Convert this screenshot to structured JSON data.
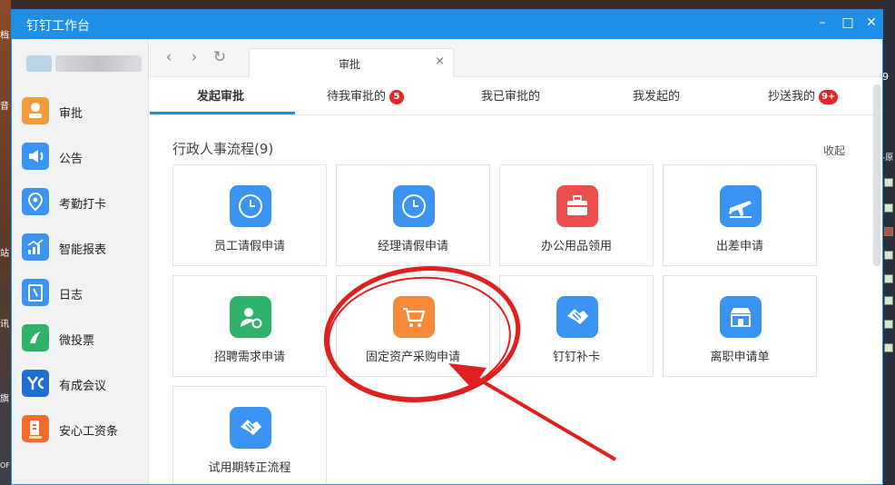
{
  "window": {
    "title": "钉钉工作台"
  },
  "colors": {
    "accent": "#1d8fe8",
    "badge": "#e6242a",
    "annotation": "#e02020"
  },
  "desktop": {
    "left_glyphs": [
      "档",
      "音",
      "站",
      "讯",
      "旗",
      "OF"
    ],
    "right_glyphs": [
      "9",
      "-原"
    ]
  },
  "sidebar": {
    "items": [
      {
        "label": "审批",
        "icon": "approval-icon"
      },
      {
        "label": "公告",
        "icon": "announcement-icon"
      },
      {
        "label": "考勤打卡",
        "icon": "attendance-icon"
      },
      {
        "label": "智能报表",
        "icon": "report-icon"
      },
      {
        "label": "日志",
        "icon": "log-icon"
      },
      {
        "label": "微投票",
        "icon": "vote-icon"
      },
      {
        "label": "有成会议",
        "icon": "meeting-icon"
      },
      {
        "label": "安心工资条",
        "icon": "salary-icon"
      }
    ]
  },
  "toolbar": {
    "back": "‹",
    "forward": "›",
    "refresh": "↻",
    "tab_title": "审批",
    "tab_close": "×"
  },
  "subtabs": [
    {
      "label": "发起审批",
      "badge": ""
    },
    {
      "label": "待我审批的",
      "badge": "5"
    },
    {
      "label": "我已审批的",
      "badge": ""
    },
    {
      "label": "我发起的",
      "badge": ""
    },
    {
      "label": "抄送我的",
      "badge": "9+"
    }
  ],
  "section": {
    "title": "行政人事流程(9)",
    "collapse": "收起"
  },
  "cards": [
    {
      "label": "员工请假申请",
      "icon": "clock-icon",
      "color": "#3c94f2"
    },
    {
      "label": "经理请假申请",
      "icon": "clock-icon",
      "color": "#3c94f2"
    },
    {
      "label": "办公用品领用",
      "icon": "toolbox-icon",
      "color": "#ec4d4d"
    },
    {
      "label": "出差申请",
      "icon": "airplane-icon",
      "color": "#3c94f2"
    },
    {
      "label": "招聘需求申请",
      "icon": "recruit-icon",
      "color": "#2fb36b"
    },
    {
      "label": "固定资产采购申请",
      "icon": "cart-icon",
      "color": "#f58a3a"
    },
    {
      "label": "钉钉补卡",
      "icon": "handshake-icon",
      "color": "#3c94f2"
    },
    {
      "label": "离职申请单",
      "icon": "store-icon",
      "color": "#3c94f2"
    },
    {
      "label": "试用期转正流程",
      "icon": "handshake-icon",
      "color": "#3c94f2"
    }
  ]
}
